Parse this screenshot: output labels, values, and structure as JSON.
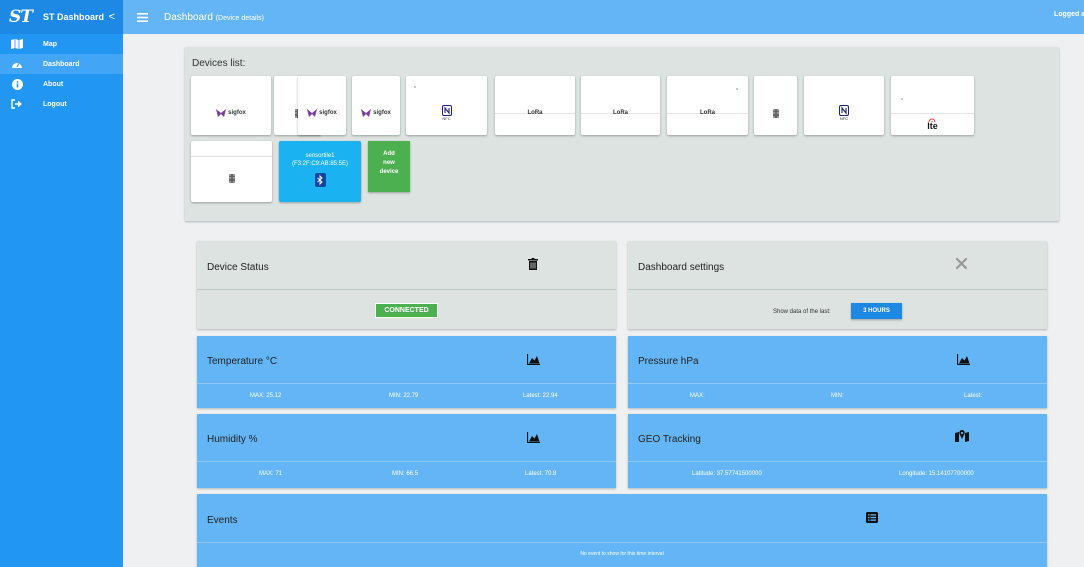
{
  "sidebar": {
    "logo": "ST",
    "brand": "ST Dashboard",
    "collapse": "<",
    "items": [
      {
        "label": "Map",
        "icon": "map-icon",
        "active": false
      },
      {
        "label": "Dashboard",
        "icon": "dashboard-icon",
        "active": true
      },
      {
        "label": "About",
        "icon": "info-icon",
        "active": false
      },
      {
        "label": "Logout",
        "icon": "logout-icon",
        "active": false
      }
    ]
  },
  "topbar": {
    "title": "Dashboard",
    "subtitle": "(Device details)",
    "logged": "Logged as"
  },
  "devices": {
    "title": "Devices list:",
    "cards": [
      {
        "kind": "sigfox",
        "label": "sigfox"
      },
      {
        "kind": "chip"
      },
      {
        "kind": "sigfox",
        "label": "sigfox"
      },
      {
        "kind": "sigfox",
        "label": "sigfox"
      },
      {
        "kind": "nfc",
        "label": "NFC"
      },
      {
        "kind": "lora",
        "label": "LoRa"
      },
      {
        "kind": "lora",
        "label": "LoRa"
      },
      {
        "kind": "lora",
        "label": "LoRa"
      },
      {
        "kind": "chip"
      },
      {
        "kind": "nfc",
        "label": "NFC"
      },
      {
        "kind": "lte",
        "label": "lte"
      },
      {
        "kind": "chip"
      }
    ],
    "selected": {
      "name": "sensortile1",
      "mac": "(F3:2F:C9:AB:85:5E)"
    },
    "add_line1": "Add",
    "add_line2": "new",
    "add_line3": "device"
  },
  "status": {
    "title": "Device Status",
    "badge": "CONNECTED"
  },
  "settings": {
    "title": "Dashboard settings",
    "show_label": "Show data of the last:",
    "range": "3 HOURS"
  },
  "temperature": {
    "title": "Temperature °C",
    "max": "MAX: 25.12",
    "min": "MIN: 22.79",
    "latest": "Latest: 22.94"
  },
  "pressure": {
    "title": "Pressure hPa",
    "max": "MAX:",
    "min": "MIN:",
    "latest": "Latest:"
  },
  "humidity": {
    "title": "Humidity %",
    "max": "MAX: 71",
    "min": "MIN: 66.5",
    "latest": "Latest: 70.8"
  },
  "geo": {
    "title": "GEO Tracking",
    "lat": "Latitude: 37.57741500000",
    "lon": "Longitude: 15.14107700000"
  },
  "events": {
    "title": "Events",
    "message": "No event to show for this time interval"
  },
  "colors": {
    "sidebar": "#2196f3",
    "topbar": "#64b5f6",
    "card_blue": "#64b5f6",
    "card_gray": "#dce3e0",
    "connected": "#4caf50",
    "selected_device": "#1ab2f0"
  }
}
